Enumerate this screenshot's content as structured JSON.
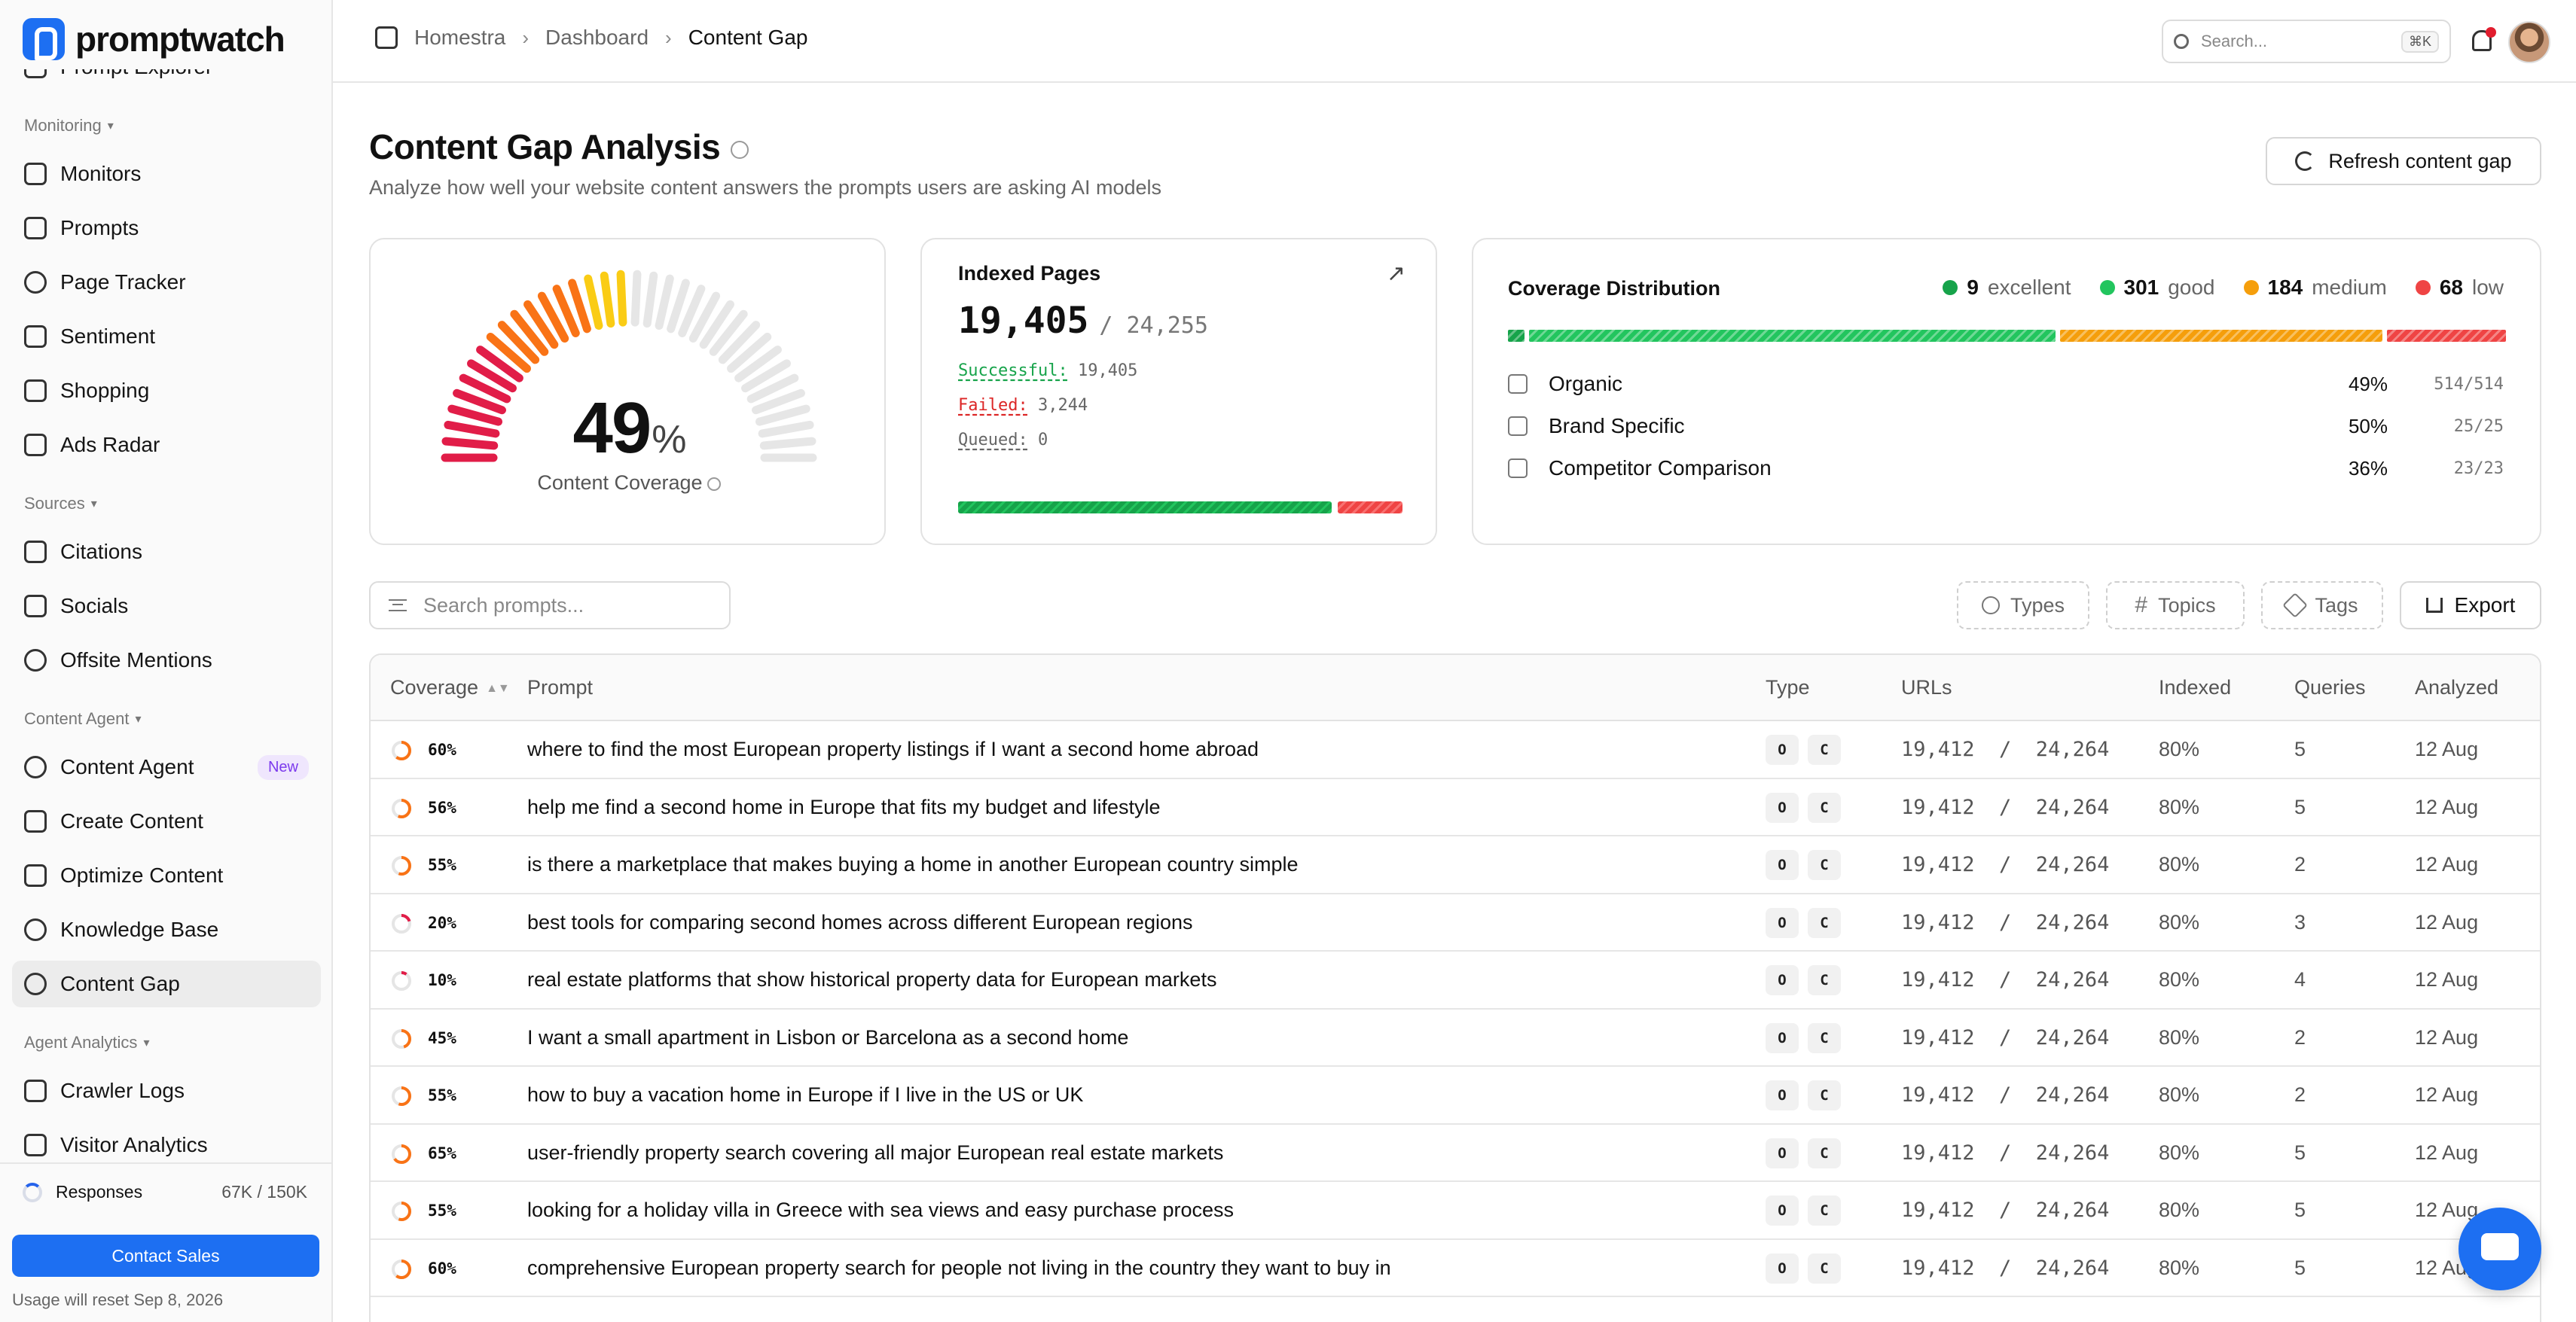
{
  "brand": {
    "name": "promptwatch",
    "accent": "#1d6ff2"
  },
  "sidebar": {
    "items": [
      {
        "type": "item",
        "label": "Prompt Explorer",
        "icon": "compass-icon"
      },
      {
        "type": "section",
        "label": "Monitoring"
      },
      {
        "type": "item",
        "label": "Monitors",
        "icon": "binoculars-icon"
      },
      {
        "type": "item",
        "label": "Prompts",
        "icon": "message-icon"
      },
      {
        "type": "item",
        "label": "Page Tracker",
        "icon": "target-icon"
      },
      {
        "type": "item",
        "label": "Sentiment",
        "icon": "shield-icon"
      },
      {
        "type": "item",
        "label": "Shopping",
        "icon": "cart-icon"
      },
      {
        "type": "item",
        "label": "Ads Radar",
        "icon": "megaphone-icon"
      },
      {
        "type": "section",
        "label": "Sources"
      },
      {
        "type": "item",
        "label": "Citations",
        "icon": "quote-icon"
      },
      {
        "type": "item",
        "label": "Socials",
        "icon": "users-icon"
      },
      {
        "type": "item",
        "label": "Offsite Mentions",
        "icon": "share-icon"
      },
      {
        "type": "section",
        "label": "Content Agent"
      },
      {
        "type": "item",
        "label": "Content Agent",
        "icon": "sparkle-icon",
        "badge": "New"
      },
      {
        "type": "item",
        "label": "Create Content",
        "icon": "document-icon"
      },
      {
        "type": "item",
        "label": "Optimize Content",
        "icon": "image-chart-icon"
      },
      {
        "type": "item",
        "label": "Knowledge Base",
        "icon": "brain-icon"
      },
      {
        "type": "item",
        "label": "Content Gap",
        "icon": "puzzle-icon",
        "active": true
      },
      {
        "type": "section",
        "label": "Agent Analytics"
      },
      {
        "type": "item",
        "label": "Crawler Logs",
        "icon": "robot-icon"
      },
      {
        "type": "item",
        "label": "Visitor Analytics",
        "icon": "chart-icon"
      }
    ],
    "responses_label": "Responses",
    "responses_count": "67K / 150K",
    "contact_label": "Contact Sales",
    "reset_note": "Usage will reset Sep 8, 2026"
  },
  "topbar": {
    "breadcrumb": [
      "Homestra",
      "Dashboard",
      "Content Gap"
    ],
    "search_placeholder": "Search...",
    "search_shortcut": "⌘K"
  },
  "page": {
    "title": "Content Gap Analysis",
    "subtitle": "Analyze how well your website content answers the prompts users are asking AI models",
    "refresh_label": "Refresh content gap"
  },
  "coverage_card": {
    "value": 49,
    "value_label": "49",
    "unit": "%",
    "label": "Content Coverage",
    "colors": [
      "#e11d48",
      "#f97316",
      "#facc15"
    ]
  },
  "indexed_pages": {
    "title": "Indexed Pages",
    "count": "19,405",
    "total": "/ 24,255",
    "successful_label": "Successful:",
    "successful_value": "19,405",
    "failed_label": "Failed:",
    "failed_value": "3,244",
    "queued_label": "Queued:",
    "queued_value": "0",
    "success_fraction": 0.855,
    "success_color": "#16a34a",
    "fail_color": "#ef4444"
  },
  "distribution": {
    "title": "Coverage Distribution",
    "legend": [
      {
        "count": "9",
        "label": "excellent",
        "color": "#16a34a",
        "value": 9
      },
      {
        "count": "301",
        "label": "good",
        "color": "#22c55e",
        "value": 301
      },
      {
        "count": "184",
        "label": "medium",
        "color": "#f59e0b",
        "value": 184
      },
      {
        "count": "68",
        "label": "low",
        "color": "#ef4444",
        "value": 68
      }
    ],
    "rows": [
      {
        "label": "Organic",
        "pct": "49%",
        "fraction": "514/514",
        "icon": "sprout-icon"
      },
      {
        "label": "Brand Specific",
        "pct": "50%",
        "fraction": "25/25",
        "icon": "building-icon"
      },
      {
        "label": "Competitor Comparison",
        "pct": "36%",
        "fraction": "23/23",
        "icon": "swords-icon"
      }
    ]
  },
  "toolbar": {
    "search_placeholder": "Search prompts...",
    "types_label": "Types",
    "topics_label": "Topics",
    "tags_label": "Tags",
    "export_label": "Export"
  },
  "table": {
    "columns": [
      "Coverage",
      "Prompt",
      "Type",
      "URLs",
      "Indexed",
      "Queries",
      "Analyzed"
    ],
    "rows": [
      {
        "coverage": 60,
        "coverage_label": "60%",
        "prompt": "where to find the most European property listings if I want a second home abroad",
        "types": [
          "O",
          "C"
        ],
        "urls": "19,412  /  24,264",
        "indexed": "80%",
        "queries": "5",
        "analyzed": "12 Aug"
      },
      {
        "coverage": 56,
        "coverage_label": "56%",
        "prompt": "help me find a second home in Europe that fits my budget and lifestyle",
        "types": [
          "O",
          "C"
        ],
        "urls": "19,412  /  24,264",
        "indexed": "80%",
        "queries": "5",
        "analyzed": "12 Aug"
      },
      {
        "coverage": 55,
        "coverage_label": "55%",
        "prompt": "is there a marketplace that makes buying a home in another European country simple",
        "types": [
          "O",
          "C"
        ],
        "urls": "19,412  /  24,264",
        "indexed": "80%",
        "queries": "2",
        "analyzed": "12 Aug"
      },
      {
        "coverage": 20,
        "coverage_label": "20%",
        "prompt": "best tools for comparing second homes across different European regions",
        "types": [
          "O",
          "C"
        ],
        "urls": "19,412  /  24,264",
        "indexed": "80%",
        "queries": "3",
        "analyzed": "12 Aug"
      },
      {
        "coverage": 10,
        "coverage_label": "10%",
        "prompt": "real estate platforms that show historical property data for European markets",
        "types": [
          "O",
          "C"
        ],
        "urls": "19,412  /  24,264",
        "indexed": "80%",
        "queries": "4",
        "analyzed": "12 Aug"
      },
      {
        "coverage": 45,
        "coverage_label": "45%",
        "prompt": "I want a small apartment in Lisbon or Barcelona as a second home",
        "types": [
          "O",
          "C"
        ],
        "urls": "19,412  /  24,264",
        "indexed": "80%",
        "queries": "2",
        "analyzed": "12 Aug"
      },
      {
        "coverage": 55,
        "coverage_label": "55%",
        "prompt": "how to buy a vacation home in Europe if I live in the US or UK",
        "types": [
          "O",
          "C"
        ],
        "urls": "19,412  /  24,264",
        "indexed": "80%",
        "queries": "2",
        "analyzed": "12 Aug"
      },
      {
        "coverage": 65,
        "coverage_label": "65%",
        "prompt": "user-friendly property search covering all major European real estate markets",
        "types": [
          "O",
          "C"
        ],
        "urls": "19,412  /  24,264",
        "indexed": "80%",
        "queries": "5",
        "analyzed": "12 Aug"
      },
      {
        "coverage": 55,
        "coverage_label": "55%",
        "prompt": "looking for a holiday villa in Greece with sea views and easy purchase process",
        "types": [
          "O",
          "C"
        ],
        "urls": "19,412  /  24,264",
        "indexed": "80%",
        "queries": "5",
        "analyzed": "12 Aug"
      },
      {
        "coverage": 60,
        "coverage_label": "60%",
        "prompt": "comprehensive European property search for people not living in the country they want to buy in",
        "types": [
          "O",
          "C"
        ],
        "urls": "19,412  /  24,264",
        "indexed": "80%",
        "queries": "5",
        "analyzed": "12 Aug"
      }
    ]
  }
}
